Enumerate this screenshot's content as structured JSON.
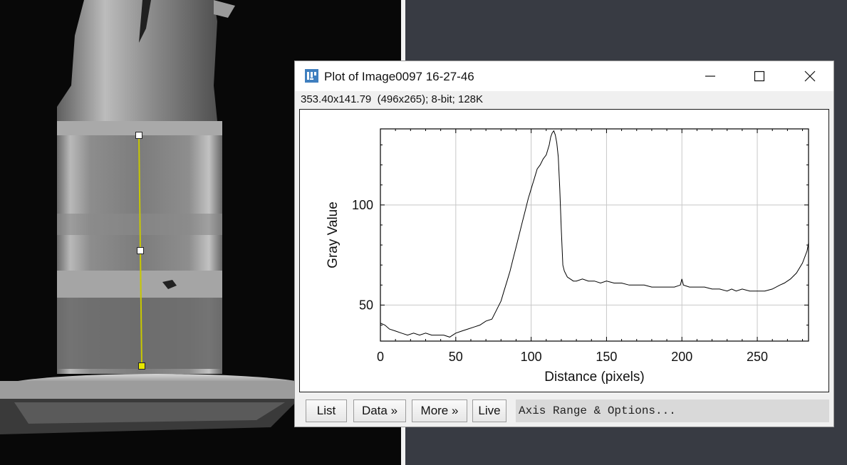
{
  "window": {
    "title": "Plot of Image0097 16-27-46",
    "info": "353.40x141.79  (496x265); 8-bit; 128K"
  },
  "buttons": {
    "list": "List",
    "data": "Data »",
    "more": "More »",
    "live": "Live",
    "axis_options": "Axis Range & Options..."
  },
  "chart_data": {
    "type": "line",
    "xlabel": "Distance (pixels)",
    "ylabel": "Gray Value",
    "xlim": [
      0,
      284
    ],
    "ylim": [
      32,
      138
    ],
    "xticks": [
      0,
      50,
      100,
      150,
      200,
      250
    ],
    "yticks": [
      50,
      100
    ],
    "grid": true,
    "line_color": "#000000",
    "series": [
      {
        "x": [
          0,
          3,
          6,
          10,
          14,
          18,
          22,
          26,
          30,
          34,
          38,
          42,
          46,
          48,
          50,
          54,
          58,
          62,
          66,
          70,
          74,
          78,
          80,
          82,
          84,
          86,
          88,
          90,
          92,
          94,
          96,
          98,
          100,
          102,
          104,
          106,
          108,
          110,
          112,
          113,
          114,
          115,
          116,
          117,
          118,
          119,
          120,
          121,
          122,
          124,
          126,
          128,
          130,
          134,
          138,
          142,
          146,
          150,
          155,
          160,
          165,
          170,
          175,
          180,
          185,
          190,
          195,
          199,
          200,
          201,
          205,
          210,
          215,
          220,
          225,
          230,
          233,
          236,
          240,
          245,
          250,
          255,
          260,
          265,
          268,
          272,
          276,
          280,
          283,
          284
        ],
        "y": [
          41,
          40,
          38,
          37,
          36,
          35,
          36,
          35,
          36,
          35,
          35,
          35,
          34,
          35,
          36,
          37,
          38,
          39,
          40,
          42,
          43,
          49,
          52,
          57,
          62,
          67,
          73,
          79,
          85,
          91,
          97,
          103,
          108,
          113,
          118,
          120,
          123,
          125,
          130,
          134,
          136,
          137,
          135,
          131,
          124,
          108,
          88,
          70,
          67,
          64,
          63,
          62,
          62,
          63,
          62,
          62,
          61,
          62,
          61,
          61,
          60,
          60,
          60,
          59,
          59,
          59,
          59,
          60,
          63,
          60,
          59,
          59,
          59,
          58,
          58,
          57,
          58,
          57,
          58,
          57,
          57,
          57,
          58,
          60,
          61,
          63,
          66,
          71,
          77,
          81
        ]
      }
    ]
  },
  "overlay": {
    "roi_line_color": "#c8c800"
  }
}
